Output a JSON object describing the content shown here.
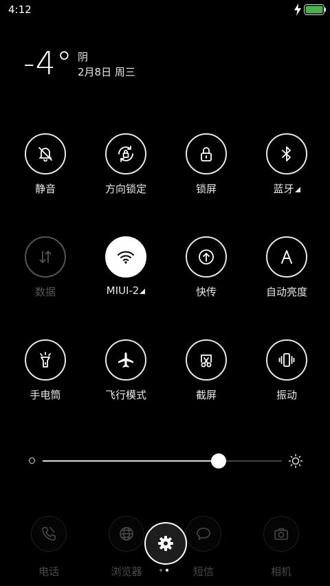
{
  "status": {
    "time": "4:12",
    "battery_color": "#4caf50"
  },
  "weather": {
    "temperature": "-4°",
    "condition": "阴",
    "date": "2月8日 周三"
  },
  "toggles": [
    {
      "label": "静音",
      "icon": "bell-off-icon",
      "state": "off"
    },
    {
      "label": "方向锁定",
      "icon": "rotation-lock-icon",
      "state": "off"
    },
    {
      "label": "锁屏",
      "icon": "lock-icon",
      "state": "off"
    },
    {
      "label": "蓝牙",
      "icon": "bluetooth-icon",
      "state": "off",
      "has_menu": true
    },
    {
      "label": "数据",
      "icon": "mobile-data-icon",
      "state": "disabled"
    },
    {
      "label": "MIUI-2",
      "icon": "wifi-icon",
      "state": "on",
      "has_menu": true
    },
    {
      "label": "快传",
      "icon": "quick-transfer-icon",
      "state": "off"
    },
    {
      "label": "自动亮度",
      "icon": "auto-brightness-icon",
      "state": "off"
    },
    {
      "label": "手电筒",
      "icon": "flashlight-icon",
      "state": "off"
    },
    {
      "label": "飞行模式",
      "icon": "airplane-icon",
      "state": "off"
    },
    {
      "label": "截屏",
      "icon": "screenshot-icon",
      "state": "off"
    },
    {
      "label": "振动",
      "icon": "vibrate-icon",
      "state": "off"
    }
  ],
  "brightness": {
    "level": 0.735
  },
  "dock": [
    {
      "label": "电话",
      "icon": "phone-icon"
    },
    {
      "label": "浏览器",
      "icon": "browser-globe-icon"
    },
    {
      "label": "短信",
      "icon": "message-icon"
    },
    {
      "label": "相机",
      "icon": "camera-icon"
    }
  ],
  "pager": {
    "count": 2,
    "active": 1
  }
}
